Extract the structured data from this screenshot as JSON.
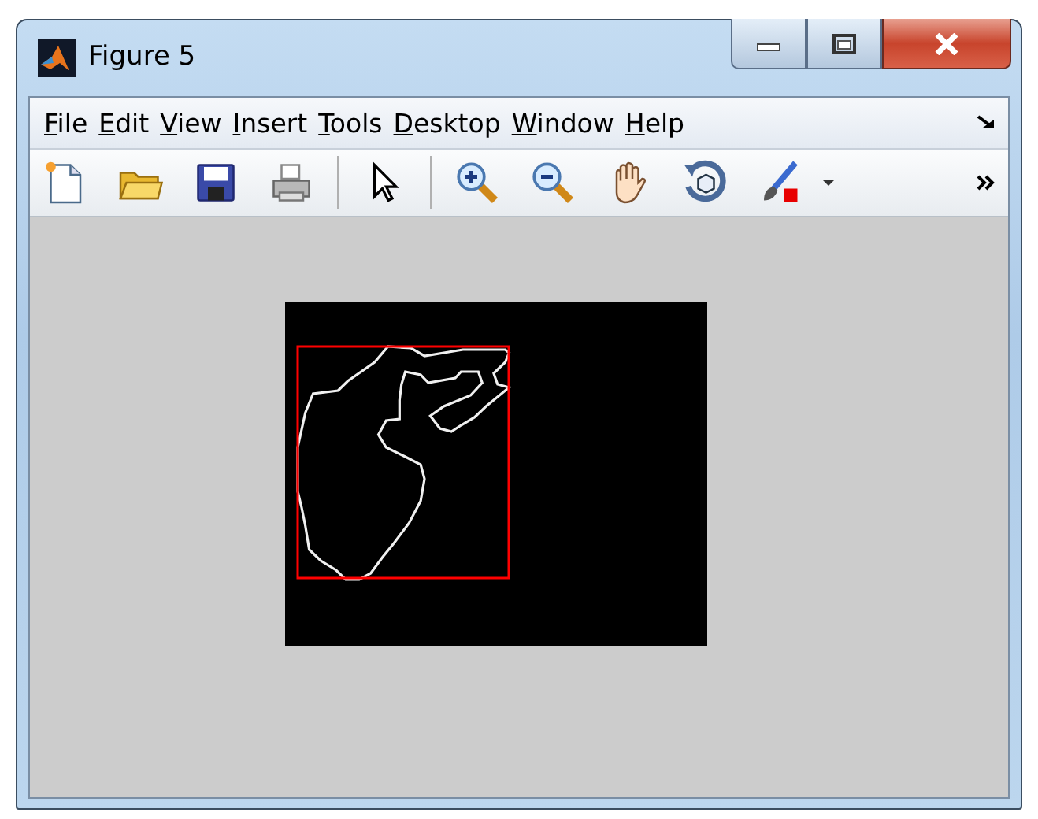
{
  "window": {
    "title": "Figure 5"
  },
  "menu": [
    {
      "label": "File"
    },
    {
      "label": "Edit"
    },
    {
      "label": "View"
    },
    {
      "label": "Insert"
    },
    {
      "label": "Tools"
    },
    {
      "label": "Desktop"
    },
    {
      "label": "Window"
    },
    {
      "label": "Help"
    }
  ]
}
